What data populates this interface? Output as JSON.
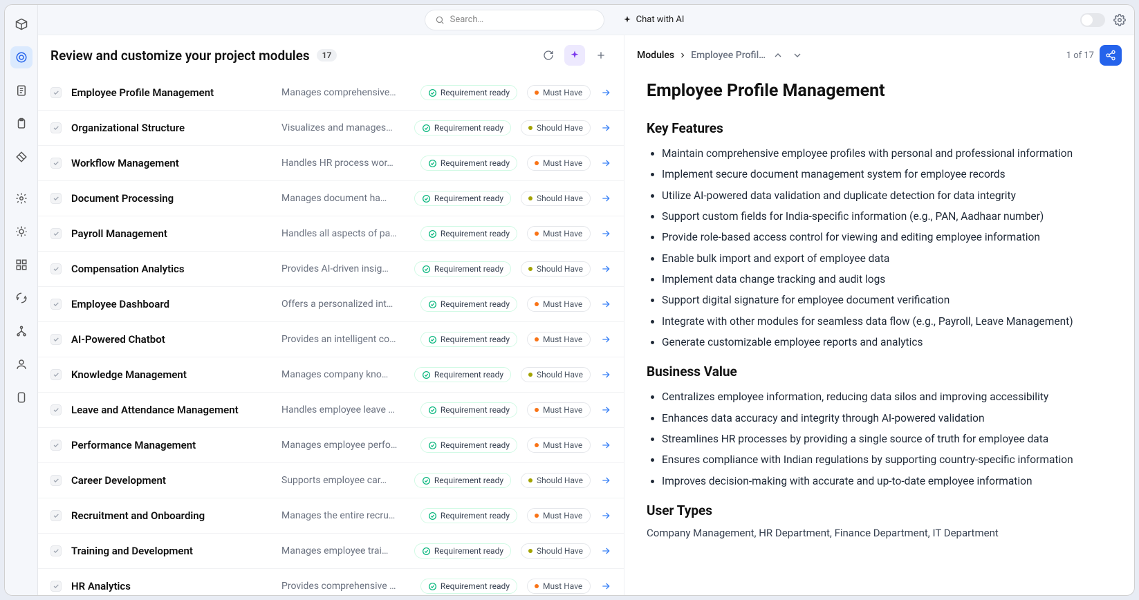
{
  "topbar": {
    "search_placeholder": "Search…",
    "chat_ai": "Chat with AI"
  },
  "left": {
    "title": "Review and customize your project modules",
    "count": "17"
  },
  "right": {
    "breadcrumb_root": "Modules",
    "breadcrumb_current": "Employee Profil…",
    "pager": "1 of 17"
  },
  "status_label": "Requirement ready",
  "priority_labels": {
    "must": "Must Have",
    "should": "Should Have"
  },
  "modules": [
    {
      "name": "Employee Profile Management",
      "desc": "Manages comprehensive…",
      "priority": "must"
    },
    {
      "name": "Organizational Structure",
      "desc": "Visualizes and manages…",
      "priority": "should"
    },
    {
      "name": "Workflow Management",
      "desc": "Handles HR process wor…",
      "priority": "must"
    },
    {
      "name": "Document Processing",
      "desc": "Manages document ha…",
      "priority": "should"
    },
    {
      "name": "Payroll Management",
      "desc": "Handles all aspects of pa…",
      "priority": "must"
    },
    {
      "name": "Compensation Analytics",
      "desc": "Provides AI-driven insig…",
      "priority": "should"
    },
    {
      "name": "Employee Dashboard",
      "desc": "Offers a personalized int…",
      "priority": "must"
    },
    {
      "name": "AI-Powered Chatbot",
      "desc": "Provides an intelligent co…",
      "priority": "must"
    },
    {
      "name": "Knowledge Management",
      "desc": "Manages company kno…",
      "priority": "should"
    },
    {
      "name": "Leave and Attendance Management",
      "desc": "Handles employee leave …",
      "priority": "must"
    },
    {
      "name": "Performance Management",
      "desc": "Manages employee perfo…",
      "priority": "must"
    },
    {
      "name": "Career Development",
      "desc": "Supports employee car…",
      "priority": "should"
    },
    {
      "name": "Recruitment and Onboarding",
      "desc": "Manages the entire recru…",
      "priority": "must"
    },
    {
      "name": "Training and Development",
      "desc": "Manages employee trai…",
      "priority": "should"
    },
    {
      "name": "HR Analytics",
      "desc": "Provides comprehensive …",
      "priority": "must"
    }
  ],
  "detail": {
    "title": "Employee Profile Management",
    "sections": [
      {
        "heading": "Key Features",
        "items": [
          "Maintain comprehensive employee profiles with personal and professional information",
          "Implement secure document management system for employee records",
          "Utilize AI-powered data validation and duplicate detection for data integrity",
          "Support custom fields for India-specific information (e.g., PAN, Aadhaar number)",
          "Provide role-based access control for viewing and editing employee information",
          "Enable bulk import and export of employee data",
          "Implement data change tracking and audit logs",
          "Support digital signature for employee document verification",
          "Integrate with other modules for seamless data flow (e.g., Payroll, Leave Management)",
          "Generate customizable employee reports and analytics"
        ]
      },
      {
        "heading": "Business Value",
        "items": [
          "Centralizes employee information, reducing data silos and improving accessibility",
          "Enhances data accuracy and integrity through AI-powered validation",
          "Streamlines HR processes by providing a single source of truth for employee data",
          "Ensures compliance with Indian regulations by supporting country-specific information",
          "Improves decision-making with accurate and up-to-date employee information"
        ]
      }
    ],
    "user_types_heading": "User Types",
    "user_types_body": "Company Management, HR Department, Finance Department, IT Department"
  }
}
